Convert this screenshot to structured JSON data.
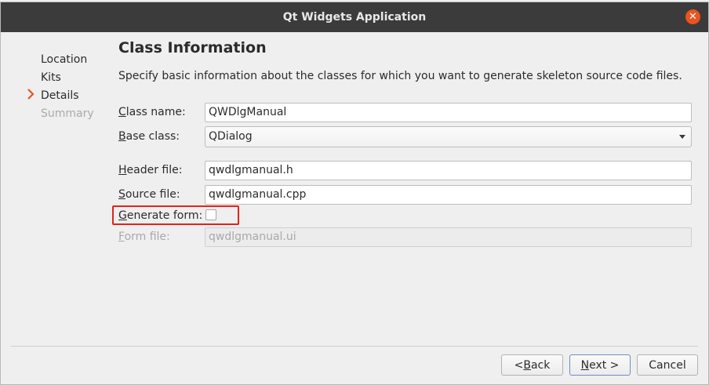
{
  "window": {
    "title": "Qt Widgets Application",
    "close_glyph": "✕"
  },
  "steps": [
    {
      "label": "Location",
      "state": "done"
    },
    {
      "label": "Kits",
      "state": "done"
    },
    {
      "label": "Details",
      "state": "current"
    },
    {
      "label": "Summary",
      "state": "pending"
    }
  ],
  "page": {
    "title": "Class Information",
    "subtitle": "Specify basic information about the classes for which you want to generate skeleton source code files."
  },
  "form": {
    "class_name": {
      "mnemonic": "C",
      "label_rest": "lass name:",
      "value": "QWDlgManual"
    },
    "base_class": {
      "mnemonic": "B",
      "label_rest": "ase class:",
      "value": "QDialog"
    },
    "header_file": {
      "mnemonic": "H",
      "label_rest": "eader file:",
      "value": "qwdlgmanual.h"
    },
    "source_file": {
      "mnemonic": "S",
      "label_rest": "ource file:",
      "value": "qwdlgmanual.cpp"
    },
    "generate_form": {
      "mnemonic": "G",
      "label_rest": "enerate form:",
      "checked": false
    },
    "form_file": {
      "mnemonic": "F",
      "label_rest": "orm file:",
      "value": "qwdlgmanual.ui",
      "enabled": false
    }
  },
  "buttons": {
    "back": {
      "prefix": "< ",
      "mnemonic": "B",
      "rest": "ack"
    },
    "next": {
      "mnemonic": "N",
      "rest": "ext >"
    },
    "cancel": {
      "label": "Cancel"
    }
  },
  "colors": {
    "accent": "#e95420",
    "highlight": "#e2231a",
    "step_arrow": "#e95420"
  },
  "icons": {
    "current_step": "chevron-right-icon",
    "close": "close-icon",
    "dropdown": "chevron-down-icon"
  }
}
